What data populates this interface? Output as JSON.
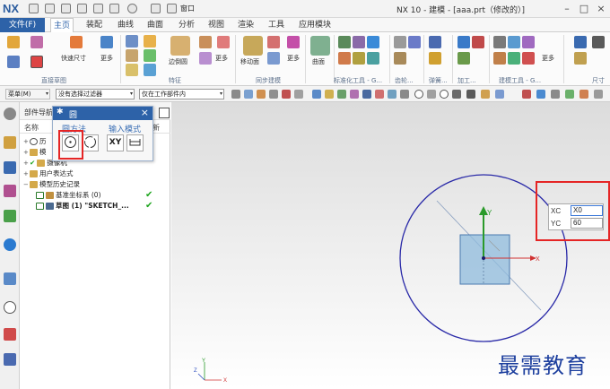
{
  "app": {
    "logo": "NX",
    "window_title": "NX 10 - 建模 - [aaa.prt（修改的）]",
    "quick_window_label": "窗口"
  },
  "menu": {
    "file": "文件(F)",
    "tabs": [
      "主页",
      "装配",
      "曲线",
      "曲面",
      "分析",
      "视图",
      "渲染",
      "工具",
      "应用模块"
    ],
    "active_index": 0
  },
  "ribbon": {
    "labels": {
      "quick_dim": "快速尺寸",
      "more1": "更多",
      "edge_blend": "边倒圆",
      "more2": "更多",
      "move_face": "移动面",
      "more3": "更多",
      "surface": "曲面",
      "more4": "更多"
    },
    "groups": {
      "direct_sketch": "直接草图",
      "feature": "特征",
      "sync_modeling": "同步建模",
      "standard_tools": "标准化工具 - G...",
      "gear": "齿轮...",
      "spring": "弹簧...",
      "machining": "加工...",
      "modeling_tools": "建模工具 - G...",
      "dimension": "尺寸"
    }
  },
  "toolbar2": {
    "menu_button": "菜单(M)",
    "filter": "没有选择过滤器",
    "scope": "仅在工作部件内"
  },
  "navigator": {
    "title": "部件导航",
    "col_name": "名称",
    "col_new": "新",
    "rows": [
      {
        "label": "历",
        "check": ""
      },
      {
        "label": "模",
        "check": ""
      },
      {
        "label": "摄像机",
        "check": ""
      },
      {
        "label": "用户表达式",
        "check": ""
      },
      {
        "label": "模型历史记录",
        "check": ""
      },
      {
        "label": "基准坐标系 (0)",
        "check": "✔"
      },
      {
        "label": "草图 (1) \"SKETCH_...",
        "check": "✔"
      }
    ]
  },
  "dialog": {
    "title": "圆",
    "section_method": "圆方法",
    "section_input": "输入模式",
    "btn_xy": "XY"
  },
  "coord_input": {
    "xc_label": "XC",
    "xc_value": "X0",
    "yc_label": "YC",
    "yc_value": "60"
  },
  "axes": {
    "x": "X",
    "y": "Y",
    "z": "Z"
  },
  "watermark": "最需教育",
  "colors": {
    "accent_blue": "#2d62a8",
    "highlight_red": "#e52525",
    "circle_blue": "#2a2aa8",
    "check_green": "#1ea51e"
  }
}
